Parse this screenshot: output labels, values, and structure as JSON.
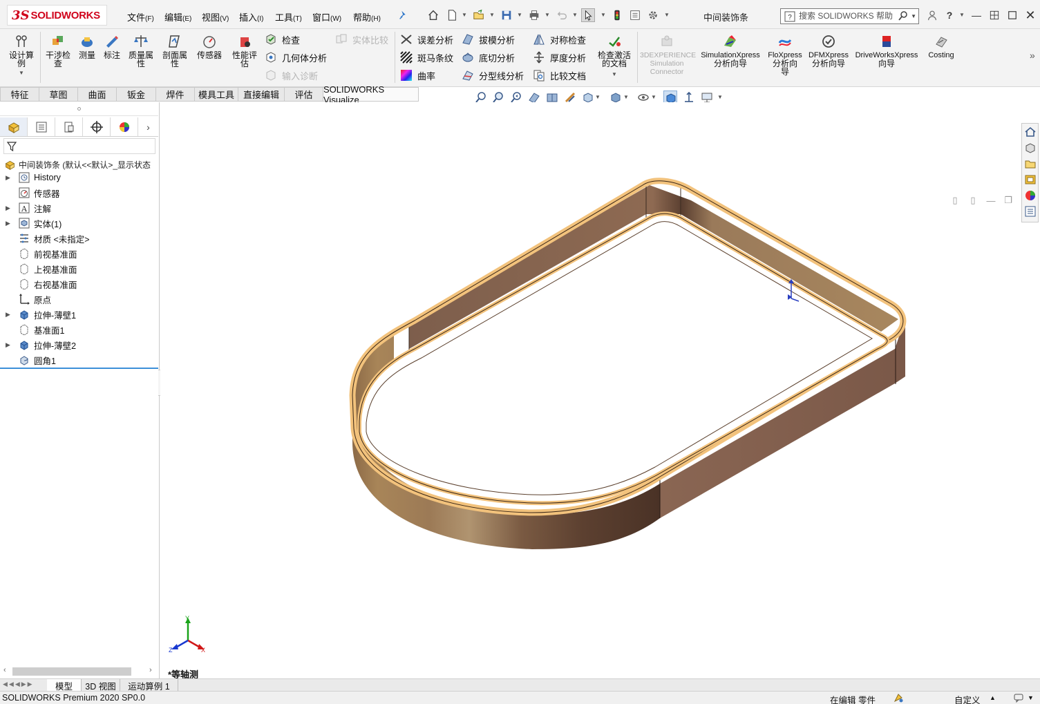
{
  "app": {
    "logo_ds": "3S",
    "logo_sw": "SOLIDWORKS",
    "document_title": "中间装饰条",
    "search_placeholder": "搜索 SOLIDWORKS 帮助",
    "help_glyph": "?"
  },
  "menu": [
    {
      "label": "文件",
      "key": "(F)"
    },
    {
      "label": "编辑",
      "key": "(E)"
    },
    {
      "label": "视图",
      "key": "(V)"
    },
    {
      "label": "插入",
      "key": "(I)"
    },
    {
      "label": "工具",
      "key": "(T)"
    },
    {
      "label": "窗口",
      "key": "(W)"
    },
    {
      "label": "帮助",
      "key": "(H)"
    }
  ],
  "toolbar_big": {
    "design_study": [
      "设计算",
      "例"
    ],
    "interference": [
      "干涉检",
      "查"
    ],
    "measure": [
      "测量"
    ],
    "markup": [
      "标注"
    ],
    "mass_props": [
      "质量属",
      "性"
    ],
    "section_props": [
      "剖面属",
      "性"
    ],
    "sensor": [
      "传感器"
    ],
    "performance": [
      "性能评",
      "估"
    ],
    "check_active": [
      "检查激活",
      "的文档"
    ],
    "experience": [
      "3DEXPERIENCE",
      "Simulation",
      "Connector"
    ],
    "simxpress": [
      "SimulationXpress",
      "分析向导"
    ],
    "floxpress": [
      "FloXpress",
      "分析向",
      "导"
    ],
    "dfmxpress": [
      "DFMXpress",
      "分析向导"
    ],
    "driveworks": [
      "DriveWorksXpress",
      "向导"
    ],
    "costing": [
      "Costing"
    ]
  },
  "toolbar_small": {
    "check": "检查",
    "geometry_analysis": "几何体分析",
    "import_diag": "输入诊断",
    "compare_body": "实体比较",
    "deviation": "误差分析",
    "zebra": "斑马条纹",
    "curvature": "曲率",
    "draft": "拔模分析",
    "undercut": "底切分析",
    "parting_line": "分型线分析",
    "symmetry": "对称检查",
    "thickness": "厚度分析",
    "compare_docs": "比较文档"
  },
  "tabs": [
    {
      "label": "特征",
      "w": 57
    },
    {
      "label": "草图",
      "w": 56
    },
    {
      "label": "曲面",
      "w": 56
    },
    {
      "label": "钣金",
      "w": 57
    },
    {
      "label": "焊件",
      "w": 56
    },
    {
      "label": "模具工具",
      "w": 63
    },
    {
      "label": "直接编辑",
      "w": 67
    },
    {
      "label": "评估",
      "w": 56
    },
    {
      "label": "SOLIDWORKS Visualize",
      "w": 138
    }
  ],
  "tree": {
    "root": "中间装饰条  (默认<<默认>_显示状态",
    "nodes": [
      {
        "label": "History",
        "expandable": true,
        "icon": "history-icon"
      },
      {
        "label": "传感器",
        "expandable": false,
        "icon": "sensor-icon"
      },
      {
        "label": "注解",
        "expandable": true,
        "icon": "annotation-icon"
      },
      {
        "label": "实体(1)",
        "expandable": true,
        "icon": "solid-bodies-icon"
      },
      {
        "label": "材质 <未指定>",
        "expandable": false,
        "icon": "material-icon"
      },
      {
        "label": "前视基准面",
        "expandable": false,
        "icon": "plane-icon"
      },
      {
        "label": "上视基准面",
        "expandable": false,
        "icon": "plane-icon"
      },
      {
        "label": "右视基准面",
        "expandable": false,
        "icon": "plane-icon"
      },
      {
        "label": "原点",
        "expandable": false,
        "icon": "origin-icon"
      },
      {
        "label": "拉伸-薄壁1",
        "expandable": true,
        "icon": "extrude-icon"
      },
      {
        "label": "基准面1",
        "expandable": false,
        "icon": "plane-icon"
      },
      {
        "label": "拉伸-薄壁2",
        "expandable": true,
        "icon": "extrude-icon"
      },
      {
        "label": "圆角1",
        "expandable": false,
        "icon": "fillet-icon"
      }
    ]
  },
  "viewport": {
    "view_name": "*等轴测",
    "triad": {
      "x": "X",
      "y": "Y",
      "z": "Z"
    }
  },
  "bottom_tabs": [
    "模型",
    "3D 视图",
    "运动算例 1"
  ],
  "status": {
    "product": "SOLIDWORKS Premium 2020 SP0.0",
    "editing": "在编辑 零件",
    "units": "自定义"
  },
  "colors": {
    "brand_red": "#d0021b",
    "part_outer": "#7a5a46",
    "part_top": "#f2c27c",
    "accent_blue": "#3c8fd8"
  }
}
